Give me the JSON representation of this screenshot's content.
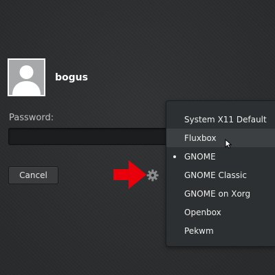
{
  "user": {
    "name": "bogus"
  },
  "login": {
    "password_label": "Password:",
    "password_value": "",
    "cancel_label": "Cancel"
  },
  "session_menu": {
    "selected": "GNOME",
    "hovered": "Fluxbox",
    "items": [
      {
        "label": "System X11 Default"
      },
      {
        "label": "Fluxbox"
      },
      {
        "label": "GNOME"
      },
      {
        "label": "GNOME Classic"
      },
      {
        "label": "GNOME on Xorg"
      },
      {
        "label": "Openbox"
      },
      {
        "label": "Pekwm"
      }
    ]
  },
  "icons": {
    "avatar": "user-avatar-icon",
    "gear": "gear-icon",
    "arrow": "red-arrow-annotation",
    "cursor": "mouse-pointer-icon",
    "bullet": "selected-bullet-icon"
  },
  "colors": {
    "background": "#2b2d2f",
    "menu_background": "#2d3032",
    "menu_hover": "#3c4043",
    "arrow": "#e8000b"
  }
}
